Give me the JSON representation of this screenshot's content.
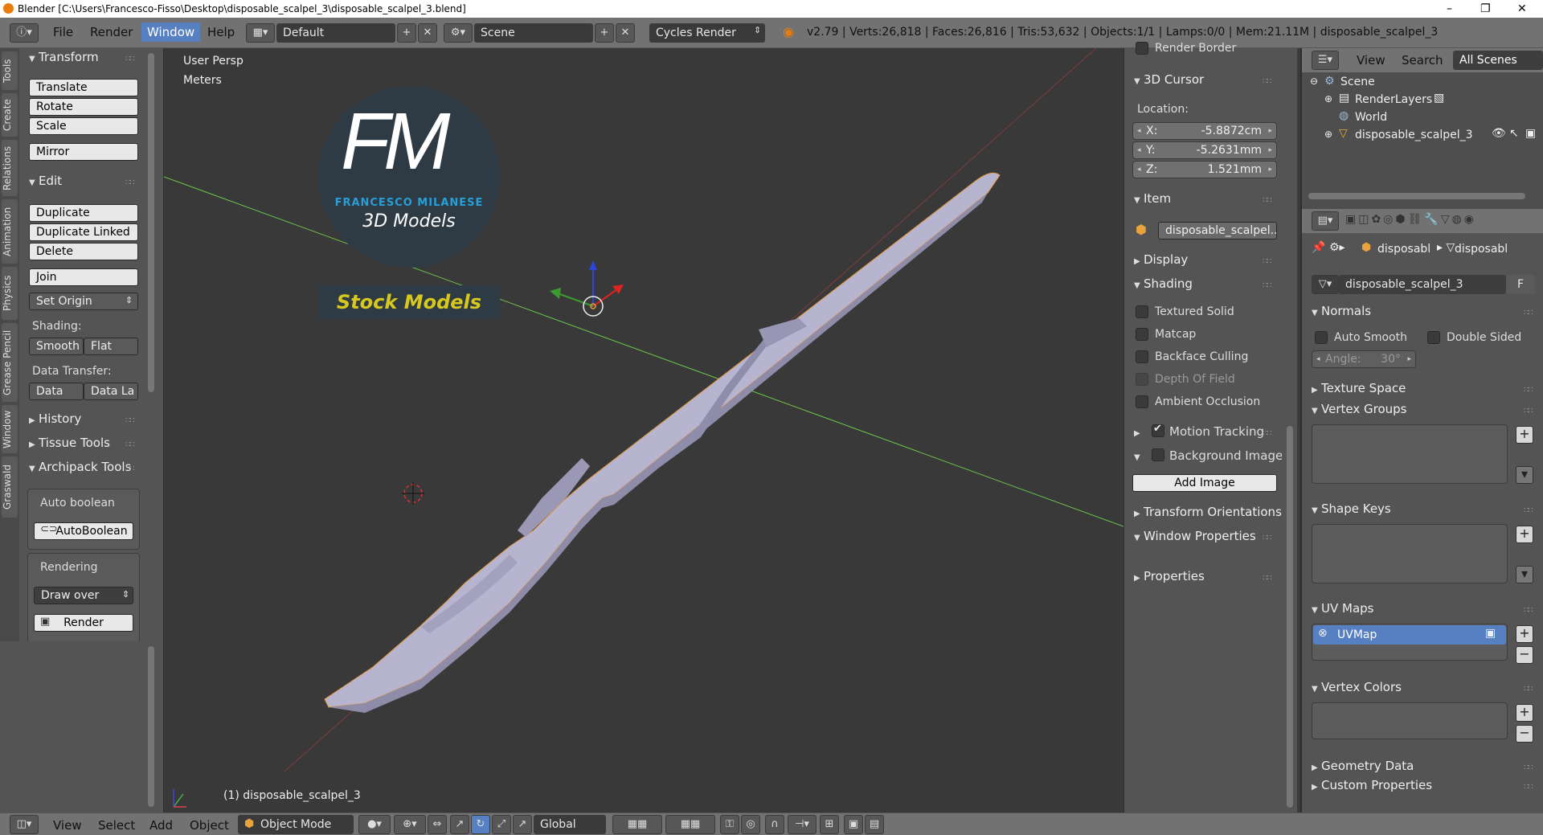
{
  "window": {
    "title": "Blender [C:\\Users\\Francesco-Fisso\\Desktop\\disposable_scalpel_3\\disposable_scalpel_3.blend]",
    "minimize": "–",
    "maximize": "❐",
    "close": "✕"
  },
  "menubar": {
    "items": [
      "File",
      "Render",
      "Window",
      "Help"
    ],
    "active": "Window",
    "layout": "Default",
    "scene": "Scene",
    "engine": "Cycles Render",
    "stats": "v2.79 | Verts:26,818 | Faces:26,816 | Tris:53,632 | Objects:1/1 | Lamps:0/0 | Mem:21.11M | disposable_scalpel_3"
  },
  "left_tabs": [
    "Tools",
    "Create",
    "Relations",
    "Animation",
    "Physics",
    "Grease Pencil",
    "Window",
    "Graswald"
  ],
  "toolshelf": {
    "transform_header": "Transform",
    "transform_buttons": [
      "Translate",
      "Rotate",
      "Scale"
    ],
    "mirror": "Mirror",
    "edit_header": "Edit",
    "edit_buttons": [
      "Duplicate",
      "Duplicate Linked",
      "Delete"
    ],
    "join": "Join",
    "set_origin": "Set Origin",
    "shading_label": "Shading:",
    "smooth": "Smooth",
    "flat": "Flat",
    "data_transfer_label": "Data Transfer:",
    "data": "Data",
    "data_la": "Data La",
    "history": "History",
    "tissue_tools": "Tissue Tools",
    "archipack": "Archipack Tools",
    "auto_boolean_label": "Auto boolean",
    "autoboolean_btn": "AutoBoolean",
    "rendering_label": "Rendering",
    "draw_over": "Draw over",
    "render_btn": "Render"
  },
  "viewport": {
    "view_name": "User Persp",
    "units": "Meters",
    "object_label": "(1) disposable_scalpel_3",
    "logo": {
      "letters": "FM",
      "name": "FRANCESCO MILANESE",
      "subtitle": "3D Models",
      "banner": "Stock Models"
    }
  },
  "npanel": {
    "render_border": "Render Border",
    "cursor_header": "3D Cursor",
    "location_label": "Location:",
    "x_key": "X:",
    "x_val": "-5.8872cm",
    "y_key": "Y:",
    "y_val": "-5.2631mm",
    "z_key": "Z:",
    "z_val": "1.521mm",
    "item_header": "Item",
    "item_name": "disposable_scalpel...",
    "display_header": "Display",
    "shading_header": "Shading",
    "shading_options": [
      "Textured Solid",
      "Matcap",
      "Backface Culling",
      "Depth Of Field",
      "Ambient Occlusion"
    ],
    "motion_tracking": "Motion Tracking",
    "background_images": "Background Images",
    "add_image": "Add Image",
    "transform_orientations": "Transform Orientations",
    "window_properties": "Window Properties",
    "properties": "Properties"
  },
  "outliner": {
    "view": "View",
    "search": "Search",
    "all_scenes": "All Scenes",
    "scene": "Scene",
    "render_layers": "RenderLayers",
    "world": "World",
    "object": "disposable_scalpel_3"
  },
  "properties": {
    "crumb1": "disposabl",
    "crumb2": "disposabl",
    "mesh_name": "disposable_scalpel_3",
    "fake_user": "F",
    "normals_header": "Normals",
    "auto_smooth": "Auto Smooth",
    "double_sided": "Double Sided",
    "angle_key": "Angle:",
    "angle_val": "30°",
    "texture_space": "Texture Space",
    "vertex_groups": "Vertex Groups",
    "shape_keys": "Shape Keys",
    "uv_maps": "UV Maps",
    "uvmap_item": "UVMap",
    "vertex_colors": "Vertex Colors",
    "geometry_data": "Geometry Data",
    "custom_properties": "Custom Properties"
  },
  "bottombar": {
    "items": [
      "View",
      "Select",
      "Add",
      "Object"
    ],
    "mode": "Object Mode",
    "orientation": "Global"
  },
  "colors": {
    "accent": "#5680c2",
    "mesh": "#b6b4cf",
    "logo_blue": "#2a9fd6",
    "logo_yellow": "#d8c81c"
  }
}
